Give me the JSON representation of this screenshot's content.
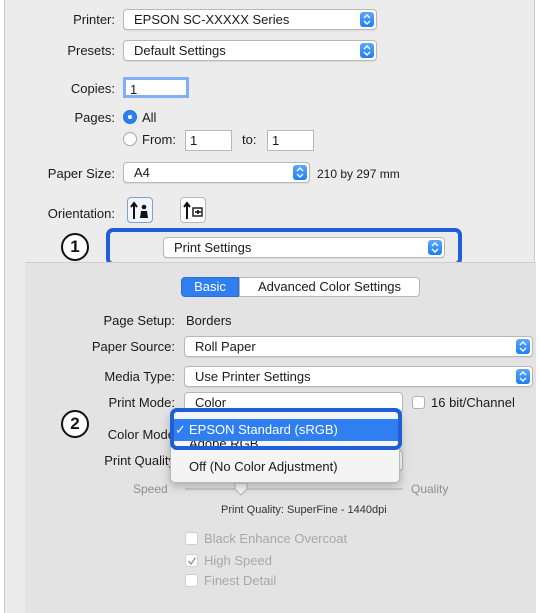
{
  "printer": {
    "label": "Printer:",
    "value": "EPSON SC-XXXXX Series"
  },
  "presets": {
    "label": "Presets:",
    "value": "Default Settings"
  },
  "copies": {
    "label": "Copies:",
    "value": "1"
  },
  "pages": {
    "label": "Pages:",
    "all_label": "All",
    "from_label": "From:",
    "from_value": "1",
    "to_label": "to:",
    "to_value": "1",
    "selected": "All"
  },
  "paper_size": {
    "label": "Paper Size:",
    "value": "A4",
    "dimensions": "210 by 297 mm"
  },
  "orientation": {
    "label": "Orientation:",
    "selected": "portrait"
  },
  "section_popup": {
    "value": "Print Settings"
  },
  "tabs": {
    "basic": "Basic",
    "advanced": "Advanced Color Settings",
    "active": "Basic"
  },
  "page_setup": {
    "label": "Page Setup:",
    "value": "Borders"
  },
  "paper_source": {
    "label": "Paper Source:",
    "value": "Roll Paper"
  },
  "media_type": {
    "label": "Media Type:",
    "value": "Use Printer Settings"
  },
  "print_mode": {
    "label": "Print Mode:",
    "value": "Color"
  },
  "bit_channel": {
    "label": "16 bit/Channel",
    "checked": false
  },
  "color_mode": {
    "label": "Color Mode",
    "options": [
      "EPSON Standard (sRGB)",
      "Adobe RGB",
      "Off (No Color Adjustment)"
    ],
    "selected": "EPSON Standard (sRGB)"
  },
  "print_quality": {
    "label": "Print Quality",
    "speed_label": "Speed",
    "quality_label": "Quality",
    "readout": "Print Quality: SuperFine - 1440dpi"
  },
  "options": {
    "black_enhance": {
      "label": "Black Enhance Overcoat",
      "checked": false
    },
    "high_speed": {
      "label": "High Speed",
      "checked": true
    },
    "finest_detail": {
      "label": "Finest Detail",
      "checked": false
    }
  },
  "callouts": {
    "one": "1",
    "two": "2"
  },
  "colors": {
    "accent": "#2f7ff0",
    "highlight": "#1e5fd8"
  }
}
